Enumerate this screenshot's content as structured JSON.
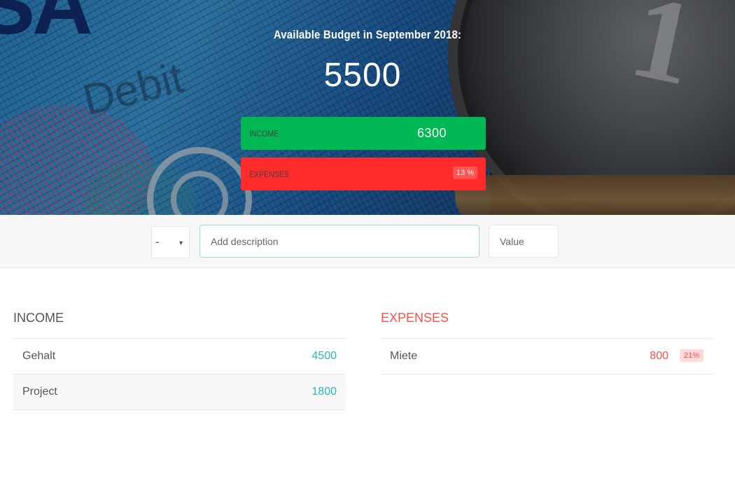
{
  "budget": {
    "title": "Available Budget in September 2018:",
    "value": "5500",
    "income_label": "Income",
    "income_value": "6300",
    "expenses_label": "Expenses",
    "expenses_percentage": "13 %"
  },
  "add": {
    "type_selected": "-",
    "description_placeholder": "Add description",
    "value_placeholder": "Value"
  },
  "income": {
    "title": "Income",
    "items": [
      {
        "description": "Gehalt",
        "value": "4500"
      },
      {
        "description": "Project",
        "value": "1800"
      }
    ]
  },
  "expenses": {
    "title": "Expenses",
    "items": [
      {
        "description": "Miete",
        "value": "800",
        "percentage": "21%"
      }
    ]
  },
  "colors": {
    "income_bar": "#00b955",
    "expenses_bar": "#ff2a2a",
    "income_text": "#28b9b5",
    "expenses_text": "#ff5049"
  }
}
